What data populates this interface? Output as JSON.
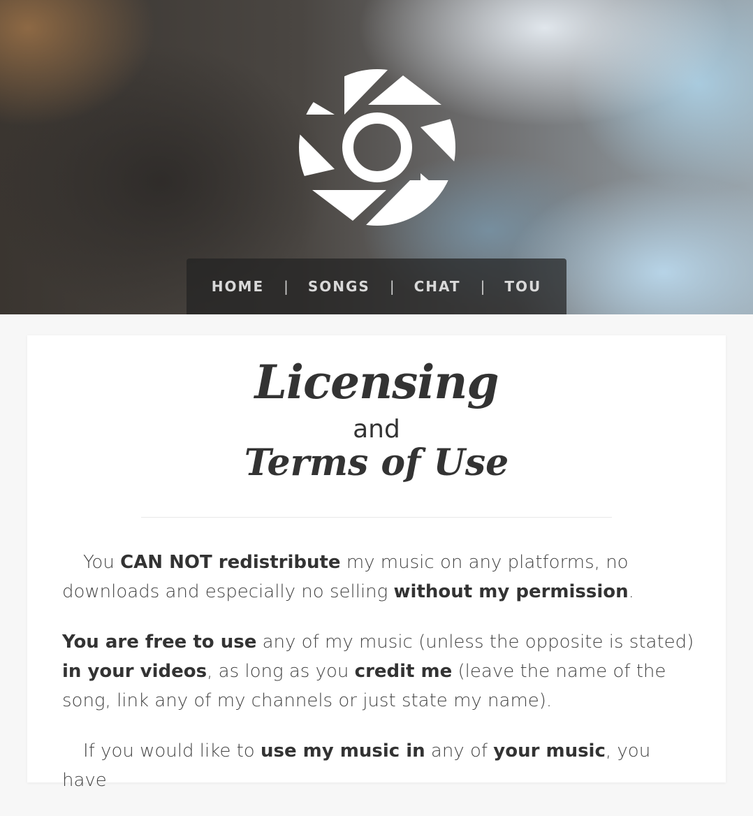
{
  "nav": {
    "items": [
      "HOME",
      "SONGS",
      "CHAT",
      "TOU"
    ],
    "separator": "|"
  },
  "title": {
    "line1": "Licensing",
    "line2": "and",
    "line3": "Terms of Use"
  },
  "paragraphs": {
    "p1": {
      "a": "You ",
      "b_bold": "CAN NOT redistribute",
      "c": " my music on any platforms, no downloads and especially no selling ",
      "d_bold": "without my permission",
      "e": "."
    },
    "p2": {
      "a_bold": "You are free to use",
      "b": " any of my music (unless the opposite is stated) ",
      "c_bold": "in your videos",
      "d": ", as long as you ",
      "e_bold": "credit me",
      "f": " (leave the name of the song, link any of my channels or just state my name)."
    },
    "p3": {
      "a": "If you would like to ",
      "b_bold": "use my music in",
      "c": " any of ",
      "d_bold": "your music",
      "e": ", you have"
    }
  },
  "icons": {
    "logo": "camera-shutter-logo"
  },
  "colors": {
    "nav_bg": "#232323",
    "text": "#444444",
    "title": "#333333"
  }
}
